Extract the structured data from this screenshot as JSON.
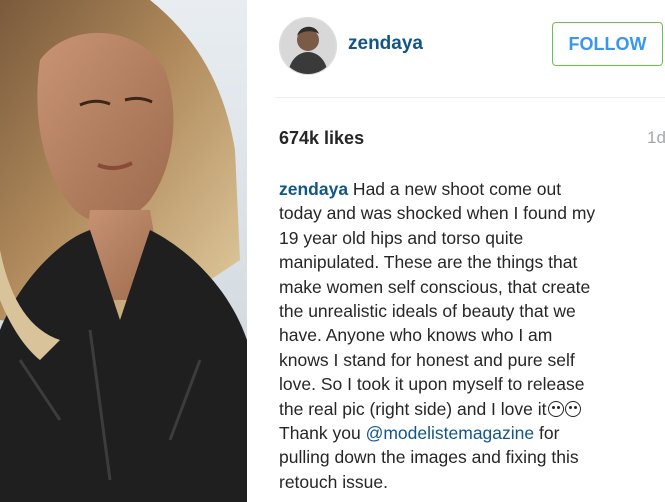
{
  "post": {
    "username": "zendaya",
    "follow_label": "FOLLOW",
    "likes": "674k likes",
    "age": "1d",
    "caption": {
      "lines": [
        " Had a new shoot come out",
        "today and was shocked when I found my",
        "19 year old hips and torso quite",
        "manipulated. These are the things that",
        "make women self conscious, that create",
        "the unrealistic ideals of beauty that we",
        "have. Anyone who knows who I am",
        "knows I stand for honest and pure self",
        "love. So I took it upon myself to release",
        "the real pic (right side) and I love it",
        "Thank you ",
        " for",
        "pulling down the images and fixing this",
        "retouch issue."
      ],
      "mention": "@modelistemagazine"
    }
  },
  "icons": {
    "emoji_1": "smiling-face-icon",
    "emoji_2": "surprised-face-icon"
  },
  "colors": {
    "username": "#125688",
    "follow_border": "#70c050",
    "follow_text": "#3897f0",
    "text": "#262626",
    "muted": "#a5a7aa"
  }
}
